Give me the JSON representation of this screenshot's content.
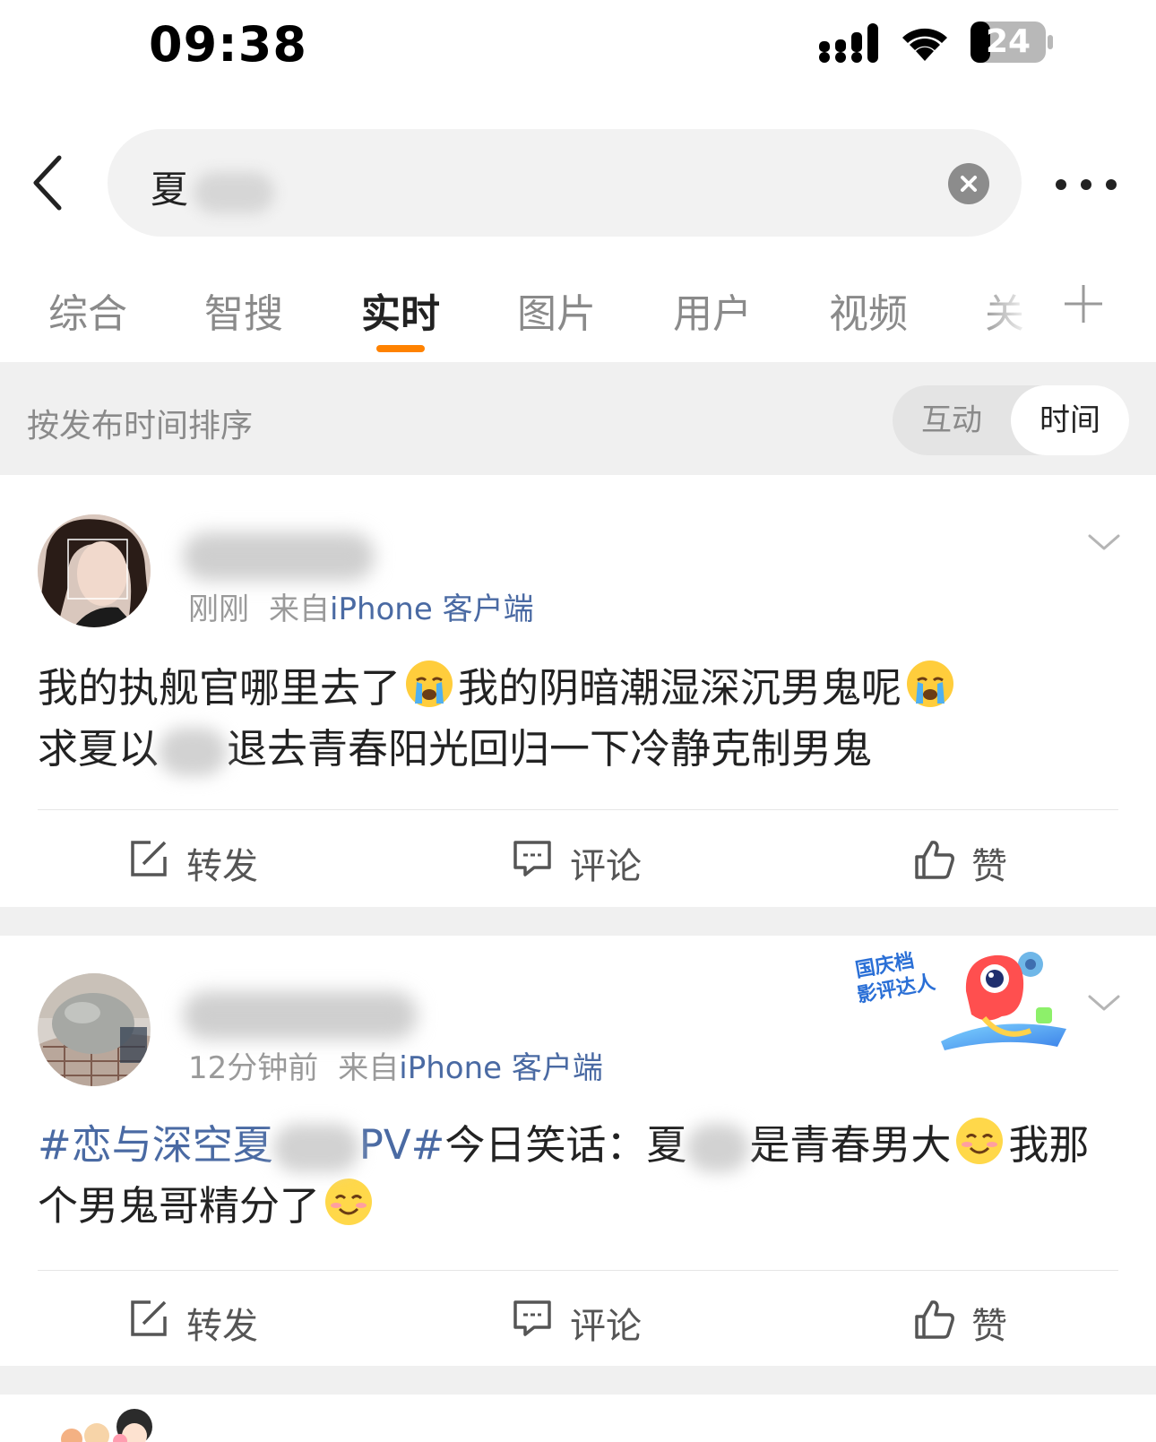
{
  "status_bar": {
    "time": "09:38",
    "battery": "24"
  },
  "search": {
    "query": "夏"
  },
  "tabs": [
    {
      "label": "综合",
      "active": false
    },
    {
      "label": "智搜",
      "active": false
    },
    {
      "label": "实时",
      "active": true
    },
    {
      "label": "图片",
      "active": false
    },
    {
      "label": "用户",
      "active": false
    },
    {
      "label": "视频",
      "active": false
    },
    {
      "label": "关",
      "active": false
    }
  ],
  "sort": {
    "label": "按发布时间排序",
    "options": [
      "互动",
      "时间"
    ],
    "selected": "时间"
  },
  "posts": [
    {
      "time": "刚刚",
      "source_prefix": "来自",
      "source": "iPhone 客户端",
      "line1_a": "我的执舰官哪里去了",
      "line1_b": "我的阴暗潮湿深沉男鬼呢",
      "line2_a": "求夏以",
      "line2_b": "退去青春阳光回归一下冷静克制男鬼",
      "actions": {
        "repost": "转发",
        "comment": "评论",
        "like": "赞"
      }
    },
    {
      "time": "12分钟前",
      "source_prefix": "来自",
      "source": "iPhone 客户端",
      "topic_a": "#恋与深空夏",
      "topic_b": "PV#",
      "text_a": "今日笑话：夏",
      "text_b": "是青春男大",
      "text_c": "我那",
      "line2": "个男鬼哥精分了",
      "badge": {
        "line1": "国庆档",
        "line2": "影评达人"
      },
      "actions": {
        "repost": "转发",
        "comment": "评论",
        "like": "赞"
      }
    }
  ],
  "colors": {
    "accent": "#ff8200",
    "link": "#4a6aa3",
    "muted": "#8a8a8a",
    "background_gray": "#f0f0f0"
  }
}
